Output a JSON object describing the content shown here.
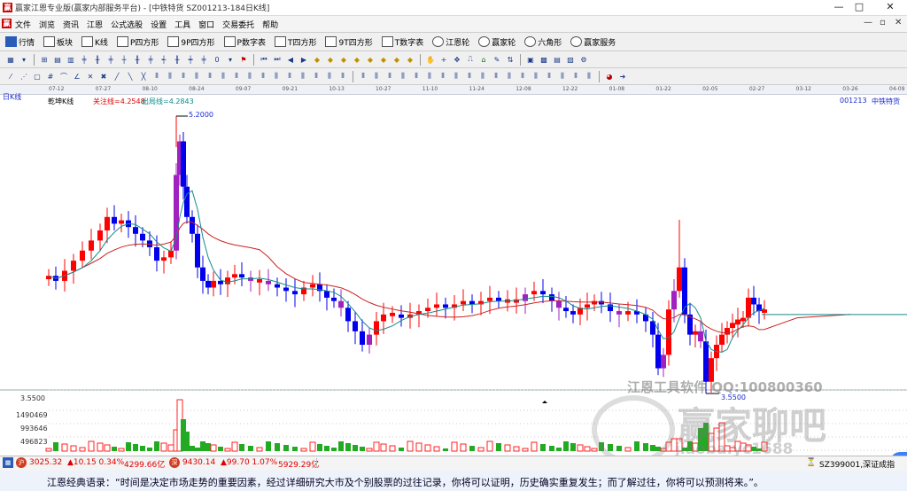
{
  "window": {
    "title": "赢家江恩专业版(赢家内部服务平台) - [中铁特货  SZ001213-184日K线]",
    "icon_name": "app-logo-icon",
    "minimize": "—",
    "maximize": "□",
    "close": "✕"
  },
  "menu": {
    "items": [
      "文件",
      "浏览",
      "资讯",
      "江恩",
      "公式选股",
      "设置",
      "工具",
      "窗口",
      "交易委托",
      "帮助"
    ],
    "mdi_min": "—",
    "mdi_restore": "▫",
    "mdi_close": "✕"
  },
  "toolbar1": {
    "items": [
      {
        "label": "行情",
        "icon": "grid-icon"
      },
      {
        "label": "板块",
        "icon": "block-icon"
      },
      {
        "label": "K线",
        "icon": "kline-icon"
      },
      {
        "label": "P四方形",
        "icon": "p-square-icon"
      },
      {
        "label": "9P四方形",
        "icon": "9p-square-icon"
      },
      {
        "label": "P数字表",
        "icon": "p-table-icon"
      },
      {
        "label": "T四方形",
        "icon": "t-square-icon"
      },
      {
        "label": "9T四方形",
        "icon": "9t-square-icon"
      },
      {
        "label": "T数字表",
        "icon": "t-table-icon"
      },
      {
        "label": "江恩轮",
        "icon": "gann-wheel-icon"
      },
      {
        "label": "赢家轮",
        "icon": "winner-wheel-icon"
      },
      {
        "label": "六角形",
        "icon": "hexagon-icon"
      },
      {
        "label": "赢家服务",
        "icon": "service-icon"
      }
    ]
  },
  "datebar": {
    "dates": [
      "07-12",
      "07-27",
      "08-10",
      "08-24",
      "09-07",
      "09-21",
      "10-13",
      "10-27",
      "11-10",
      "11-24",
      "12-08",
      "12-22",
      "01-08",
      "01-22",
      "02-05",
      "02-27",
      "03-12",
      "03-26",
      "04-09"
    ]
  },
  "chart": {
    "period_label": "日K线",
    "indicator_name": "乾坤K线",
    "guanzhu_line": "关注线=4.2548",
    "chuju_line": "出局线=4.2843",
    "stock_code": "001213",
    "stock_name": "中铁特货",
    "high_label": "5.2000",
    "low_label": "3.5500",
    "volume_labels": [
      "3.5500",
      "1490469",
      "993646",
      "496823"
    ],
    "colors": {
      "up": "#ff0000",
      "down": "#0000ee",
      "purple": "#a020c0",
      "ma_slow": "#cc2222",
      "ma_fast": "#178a8a",
      "vol_up": "#ff2020",
      "vol_down": "#22aa22"
    }
  },
  "watermark": {
    "line1": "江恩工具软件  QQ:100800360",
    "brand": "赢家聊吧",
    "url": "jiaoba.yc1688"
  },
  "statusbar": {
    "sh_value": "3025.32",
    "sh_change": "▲10.15 0.34%",
    "sh_amount": "4299.66亿",
    "sz_value": "9430.14",
    "sz_change": "▲99.70 1.07%",
    "sz_amount": "5929.29亿",
    "right_text": "SZ399001,深证成指"
  },
  "quote": {
    "text": "江恩经典语录：“时间是决定市场走势的重要因素，经过详细研究大市及个别股票的过往记录，你将可以证明，历史确实重复发生；而了解过往，你将可以预测将来。”。"
  }
}
